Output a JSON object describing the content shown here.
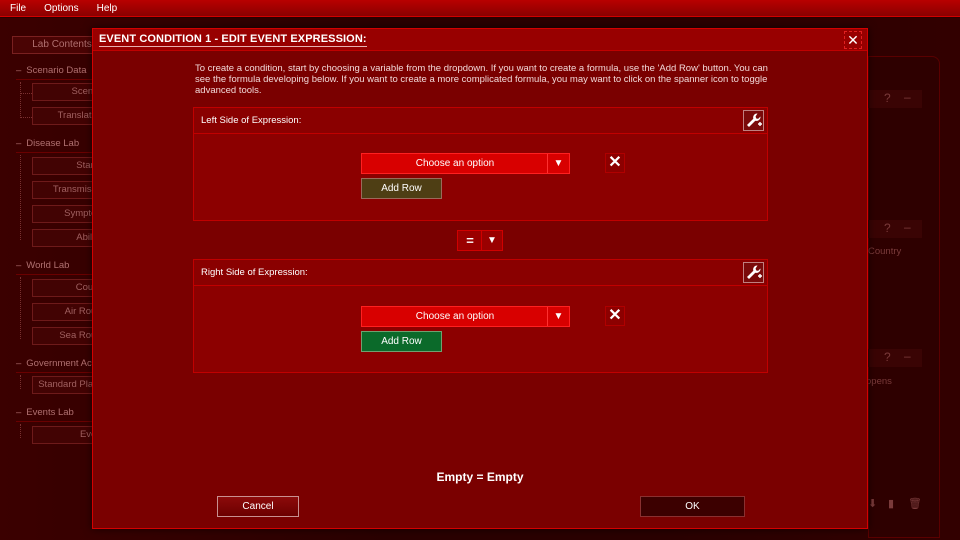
{
  "menu": {
    "items": [
      "File",
      "Options",
      "Help"
    ]
  },
  "background": {
    "lab_contents_label": "Lab Contents",
    "sections": [
      {
        "title": "Scenario Data",
        "items": [
          "Scenario",
          "Translations"
        ]
      },
      {
        "title": "Disease Lab",
        "items": [
          "Starting",
          "Transmission",
          "Symptoms",
          "Abilities"
        ]
      },
      {
        "title": "World Lab",
        "items": [
          "Country",
          "Air Routes",
          "Sea Routes"
        ]
      },
      {
        "title": "Government Actions",
        "items": [
          "Standard Plague"
        ]
      },
      {
        "title": "Events Lab",
        "items": [
          "Events"
        ]
      }
    ],
    "right_panel": {
      "help_glyph": "?",
      "minimize_glyph": "–",
      "text_country": "Country",
      "text_opens": "opens"
    }
  },
  "modal": {
    "title": "EVENT CONDITION 1 - EDIT EVENT EXPRESSION",
    "title_suffix": ":",
    "close_glyph": "✕",
    "intro": "To create a condition, start by choosing a variable from the dropdown. If you want to create a formula, use the 'Add Row' button. You can see the formula developing below. If you want to create a more complicated formula, you may want to click on the spanner icon to toggle advanced tools.",
    "left": {
      "label": "Left Side of Expression:",
      "dropdown_value": "Choose an option",
      "add_row_label": "Add Row"
    },
    "operator": {
      "value": "="
    },
    "right": {
      "label": "Right Side of Expression:",
      "dropdown_value": "Choose an option",
      "add_row_label": "Add Row"
    },
    "summary": "Empty = Empty",
    "cancel_label": "Cancel",
    "ok_label": "OK"
  },
  "colors": {
    "modal_bg": "#7a0000",
    "accent_red": "#d80000",
    "add_row_left": "#4e3e14",
    "add_row_right": "#0b6a2a"
  }
}
